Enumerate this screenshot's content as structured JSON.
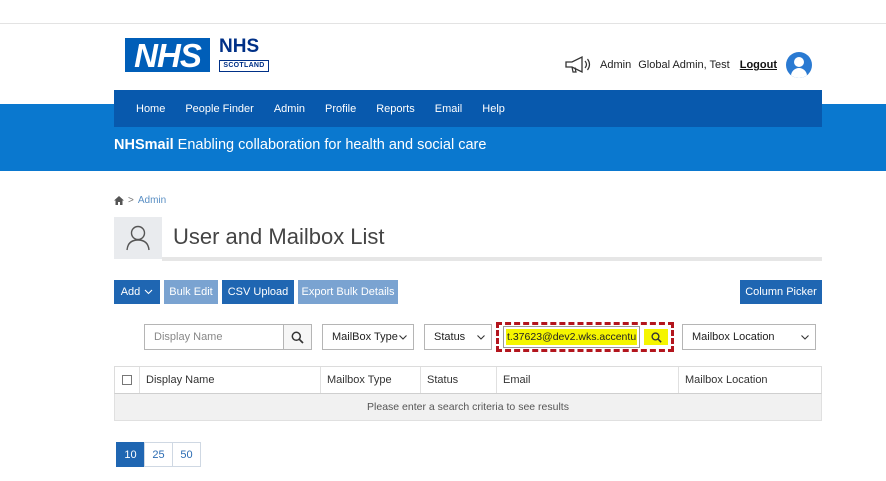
{
  "header": {
    "logo_main": "NHS",
    "logo_secondary": "NHS",
    "logo_secondary_sub": "SCOTLAND",
    "user_role": "Admin",
    "user_name": "Global Admin, Test",
    "logout_label": "Logout"
  },
  "nav": {
    "items": [
      {
        "label": "Home"
      },
      {
        "label": "People Finder"
      },
      {
        "label": "Admin"
      },
      {
        "label": "Profile"
      },
      {
        "label": "Reports"
      },
      {
        "label": "Email"
      },
      {
        "label": "Help"
      }
    ]
  },
  "tagline": {
    "brand": "NHSmail",
    "text": " Enabling collaboration for health and social care"
  },
  "breadcrumb": {
    "separator": ">",
    "current": "Admin"
  },
  "page": {
    "title": "User and Mailbox List"
  },
  "toolbar": {
    "add_label": "Add",
    "bulk_edit_label": "Bulk Edit",
    "csv_upload_label": "CSV Upload",
    "export_label": "Export Bulk Details",
    "column_picker_label": "Column Picker"
  },
  "filters": {
    "display_name_placeholder": "Display Name",
    "mailbox_type_selected": "MailBox Type",
    "status_selected": "Status",
    "email_value": "t.37623@dev2.wks.accentu",
    "mailbox_location_selected": "Mailbox Location"
  },
  "table": {
    "columns": [
      "Display Name",
      "Mailbox Type",
      "Status",
      "Email",
      "Mailbox Location"
    ],
    "empty_message": "Please enter a search criteria to see results"
  },
  "pager": {
    "sizes": [
      "10",
      "25",
      "50"
    ],
    "active": "10"
  },
  "colors": {
    "nav_dark": "#0859ad",
    "band_blue": "#0a78cf",
    "button_blue": "#1f66b2",
    "button_disabled": "#7aa3d1",
    "highlight_yellow": "#f5f500",
    "annotation_red": "#b3151d"
  }
}
